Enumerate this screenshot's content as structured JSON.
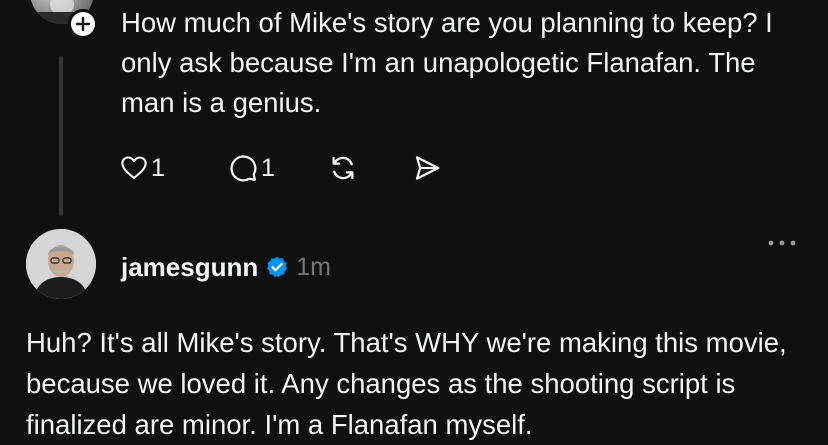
{
  "top_post": {
    "text": "How much of Mike's story are you planning to keep? I only ask because I'm an unapologetic Flanafan. The man is a genius.",
    "avatar_icon": "user-avatar-icon",
    "follow_icon": "plus-icon",
    "actions": {
      "like_count": "1",
      "comment_count": "1",
      "like_icon": "heart-icon",
      "comment_icon": "comment-bubble-icon",
      "repost_icon": "repost-icon",
      "share_icon": "send-icon"
    }
  },
  "reply_post": {
    "username": "jamesgunn",
    "timestamp": "1m",
    "text": "Huh? It's all Mike's story. That's WHY we're making this movie, because we loved it. Any changes as the shooting script is finalized are minor. I'm a Flanafan myself.",
    "verified_icon": "verified-badge-icon",
    "more_icon": "more-options-icon"
  },
  "colors": {
    "background": "#101010",
    "text": "#f3f5f7",
    "muted": "#777777",
    "thread_line": "#333638",
    "verified": "#0095f6"
  }
}
